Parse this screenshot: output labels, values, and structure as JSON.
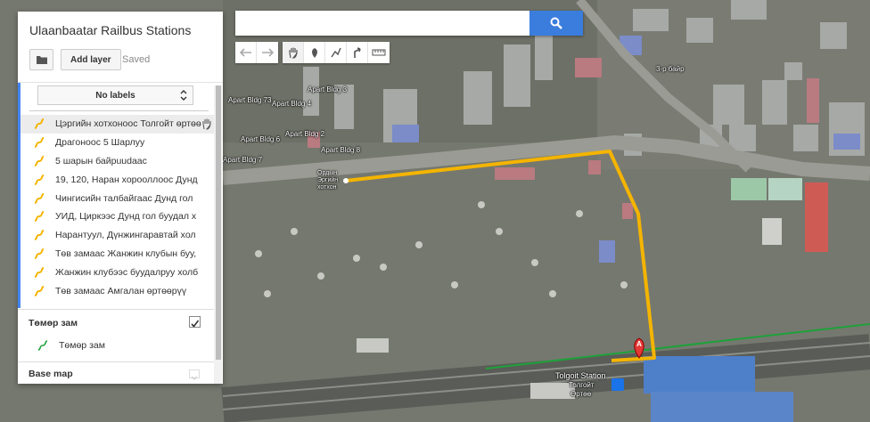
{
  "map": {
    "labels": {
      "apart3": "Apart Bldg 3",
      "apart73": "Apart Bldg 73",
      "apart4": "Apart Bldg 4",
      "apart2": "Apart Bldg 2",
      "apart6": "Apart Bldg 6",
      "apart7": "Apart Bldg 7",
      "apart8": "Apart Bldg 8",
      "bair3": "3-р байр",
      "station": "Tolgoit Station",
      "station_sub": "Толгойт",
      "station_sub2": "Өртөө",
      "start_label": "Ордын",
      "start_label2": "Эргийн",
      "start_label3": "хотхон"
    },
    "marker_letter": "A",
    "colors": {
      "route": "#f4b400",
      "railway": "#1ea13a"
    }
  },
  "search": {
    "placeholder": "",
    "value": ""
  },
  "toolbar": {
    "icons": [
      "undo-icon",
      "redo-icon",
      "hand-icon",
      "marker-icon",
      "draw-line-icon",
      "directions-icon",
      "ruler-icon"
    ]
  },
  "panel": {
    "title": "Ulaanbaatar Railbus Stations",
    "add_layer": "Add layer",
    "saved": "Saved",
    "labels_select": "No labels",
    "routes": [
      "Цэргийн хотхоноос Толгойт өртөө",
      "Драгоноос 5 Шарлуу",
      "5 шарын байрuudaac",
      "19, 120, Наран хорооллоос Дунд",
      "Чингисийн талбайгаас Дунд гол",
      "УИД, Циркээс Дунд гол буудал х",
      "Нарантуул, Дүнжингаравтай хол",
      "Төв замаас Жанжин клубын буу,",
      "Жанжин клубээс буудалруу холб",
      "Төв замаас Амгалан өртөөрүү"
    ],
    "railway_title": "Төмөр зам",
    "railway_item": "Төмөр зам",
    "basemap_title": "Base map"
  }
}
